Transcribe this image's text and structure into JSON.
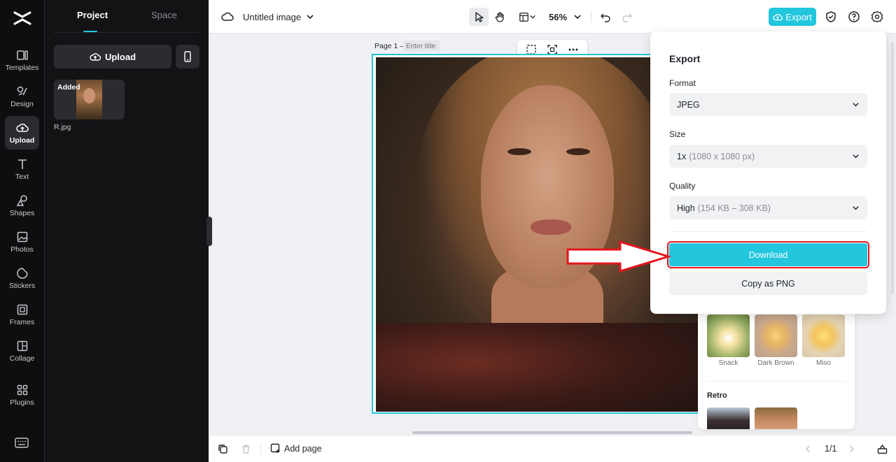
{
  "rail": {
    "items": [
      {
        "label": "Templates",
        "icon": "templates-icon"
      },
      {
        "label": "Design",
        "icon": "design-icon"
      },
      {
        "label": "Upload",
        "icon": "upload-cloud-icon"
      },
      {
        "label": "Text",
        "icon": "text-icon"
      },
      {
        "label": "Shapes",
        "icon": "shapes-icon"
      },
      {
        "label": "Photos",
        "icon": "photos-icon"
      },
      {
        "label": "Stickers",
        "icon": "stickers-icon"
      },
      {
        "label": "Frames",
        "icon": "frames-icon"
      },
      {
        "label": "Collage",
        "icon": "collage-icon"
      },
      {
        "label": "Plugins",
        "icon": "plugins-icon"
      }
    ],
    "active": "Upload"
  },
  "panel": {
    "tabs": [
      "Project",
      "Space"
    ],
    "upload_label": "Upload",
    "asset": {
      "badge": "Added",
      "name": "R.jpg"
    }
  },
  "topbar": {
    "title": "Untitled image",
    "zoom": "56%",
    "export_label": "Export"
  },
  "canvas": {
    "page_label": "Page 1 –",
    "title_placeholder": "Enter title"
  },
  "export_panel": {
    "title": "Export",
    "format_label": "Format",
    "format_value": "JPEG",
    "size_label": "Size",
    "size_value": "1x",
    "size_detail": "(1080 x 1080 px)",
    "quality_label": "Quality",
    "quality_value": "High",
    "quality_detail": "(154 KB – 308 KB)",
    "download_label": "Download",
    "copy_label": "Copy as PNG"
  },
  "filters": {
    "items": [
      {
        "label": "Snack"
      },
      {
        "label": "Dark Brown"
      },
      {
        "label": "Miso"
      }
    ],
    "section_label": "Retro"
  },
  "bottombar": {
    "add_page_label": "Add page",
    "pager": "1/1"
  },
  "colors": {
    "accent": "#22c6dd",
    "highlight": "#e3151b"
  }
}
